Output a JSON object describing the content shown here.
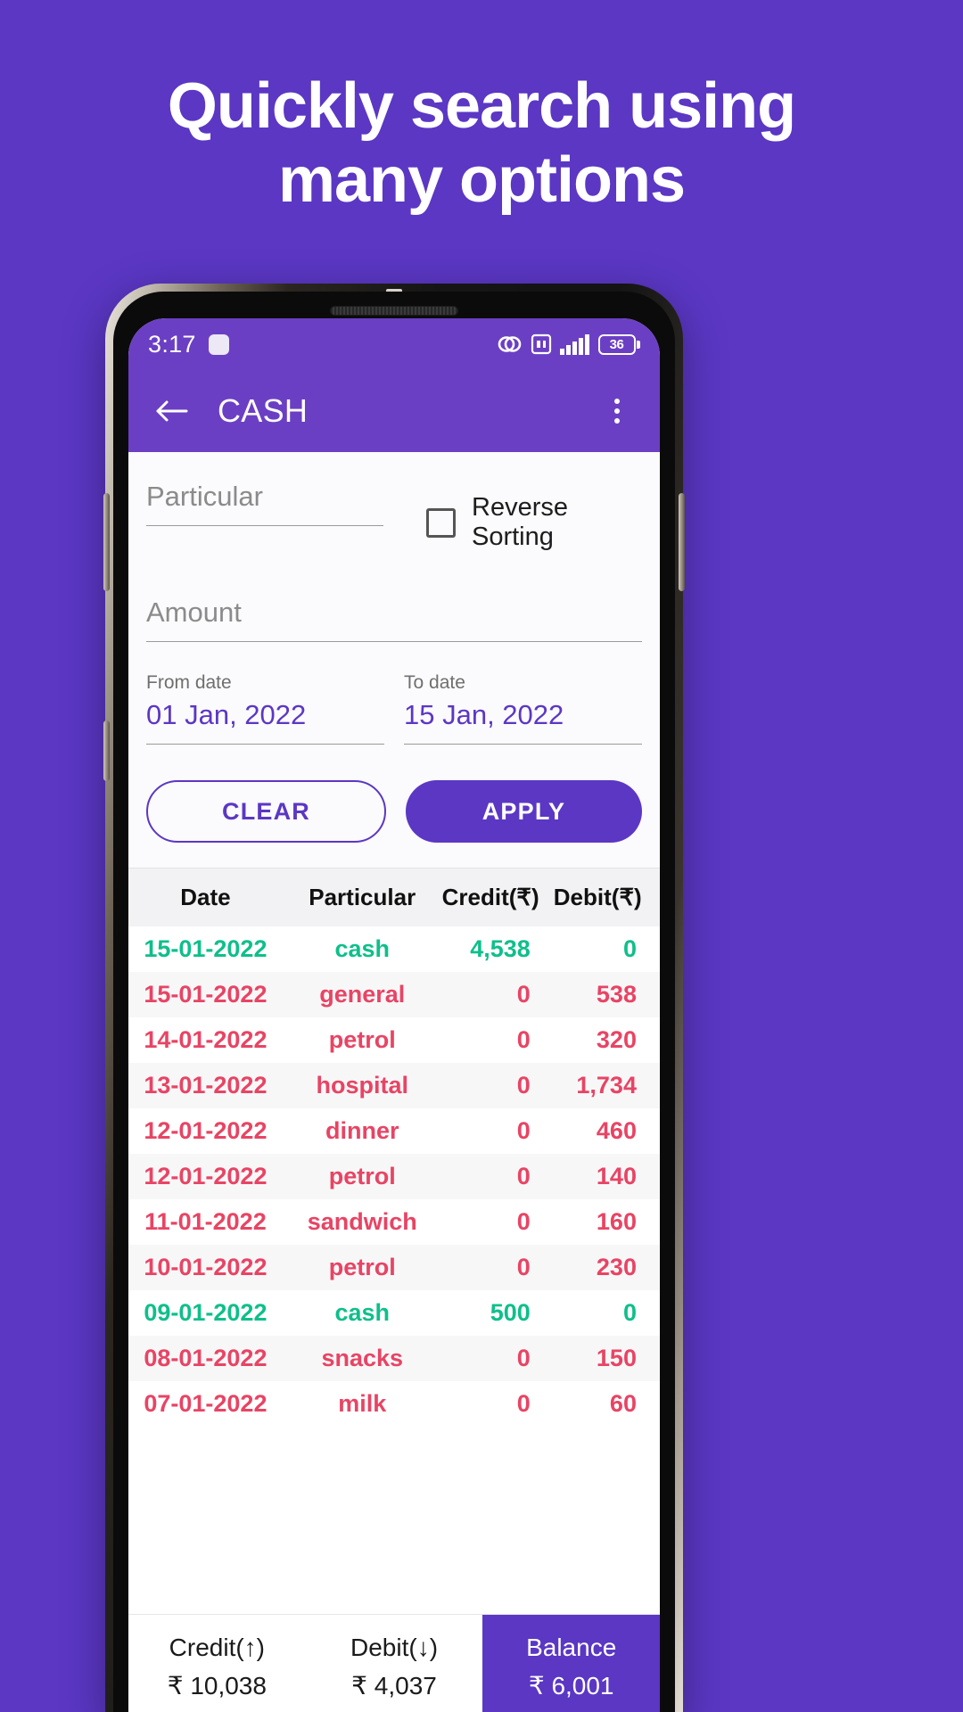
{
  "promo": {
    "headline_line1": "Quickly search using",
    "headline_line2": "many options",
    "background_color": "#5B37C4"
  },
  "status_bar": {
    "time": "3:17",
    "battery_percent": "36",
    "icons": [
      "link-icon",
      "nfc-icon",
      "signal-bars-icon",
      "battery-icon"
    ]
  },
  "app_bar": {
    "back_label": "back-arrow",
    "title": "CASH",
    "overflow_label": "more-options"
  },
  "filters": {
    "particular_placeholder": "Particular",
    "particular_value": "",
    "amount_placeholder": "Amount",
    "amount_value": "",
    "reverse_sorting_label": "Reverse Sorting",
    "reverse_sorting_checked": false,
    "from_date_label": "From date",
    "from_date_value": "01 Jan, 2022",
    "to_date_label": "To date",
    "to_date_value": "15 Jan, 2022",
    "clear_button": "CLEAR",
    "apply_button": "APPLY"
  },
  "table": {
    "headers": [
      "Date",
      "Particular",
      "Credit(₹)",
      "Debit(₹)"
    ],
    "rows": [
      {
        "date": "15-01-2022",
        "particular": "cash",
        "credit": "4,538",
        "debit": "0",
        "type": "credit"
      },
      {
        "date": "15-01-2022",
        "particular": "general",
        "credit": "0",
        "debit": "538",
        "type": "debit"
      },
      {
        "date": "14-01-2022",
        "particular": "petrol",
        "credit": "0",
        "debit": "320",
        "type": "debit"
      },
      {
        "date": "13-01-2022",
        "particular": "hospital",
        "credit": "0",
        "debit": "1,734",
        "type": "debit"
      },
      {
        "date": "12-01-2022",
        "particular": "dinner",
        "credit": "0",
        "debit": "460",
        "type": "debit"
      },
      {
        "date": "12-01-2022",
        "particular": "petrol",
        "credit": "0",
        "debit": "140",
        "type": "debit"
      },
      {
        "date": "11-01-2022",
        "particular": "sandwich",
        "credit": "0",
        "debit": "160",
        "type": "debit"
      },
      {
        "date": "10-01-2022",
        "particular": "petrol",
        "credit": "0",
        "debit": "230",
        "type": "debit"
      },
      {
        "date": "09-01-2022",
        "particular": "cash",
        "credit": "500",
        "debit": "0",
        "type": "credit"
      },
      {
        "date": "08-01-2022",
        "particular": "snacks",
        "credit": "0",
        "debit": "150",
        "type": "debit"
      },
      {
        "date": "07-01-2022",
        "particular": "milk",
        "credit": "0",
        "debit": "60",
        "type": "debit"
      }
    ]
  },
  "summary": {
    "credit_label": "Credit(↑)",
    "credit_value": "₹ 10,038",
    "debit_label": "Debit(↓)",
    "debit_value": "₹ 4,037",
    "balance_label": "Balance",
    "balance_value": "₹ 6,001"
  },
  "colors": {
    "brand_purple": "#5B37C4",
    "appbar_purple": "#6B3FC4",
    "credit_green": "#0FBF8B",
    "debit_red": "#E84464"
  }
}
